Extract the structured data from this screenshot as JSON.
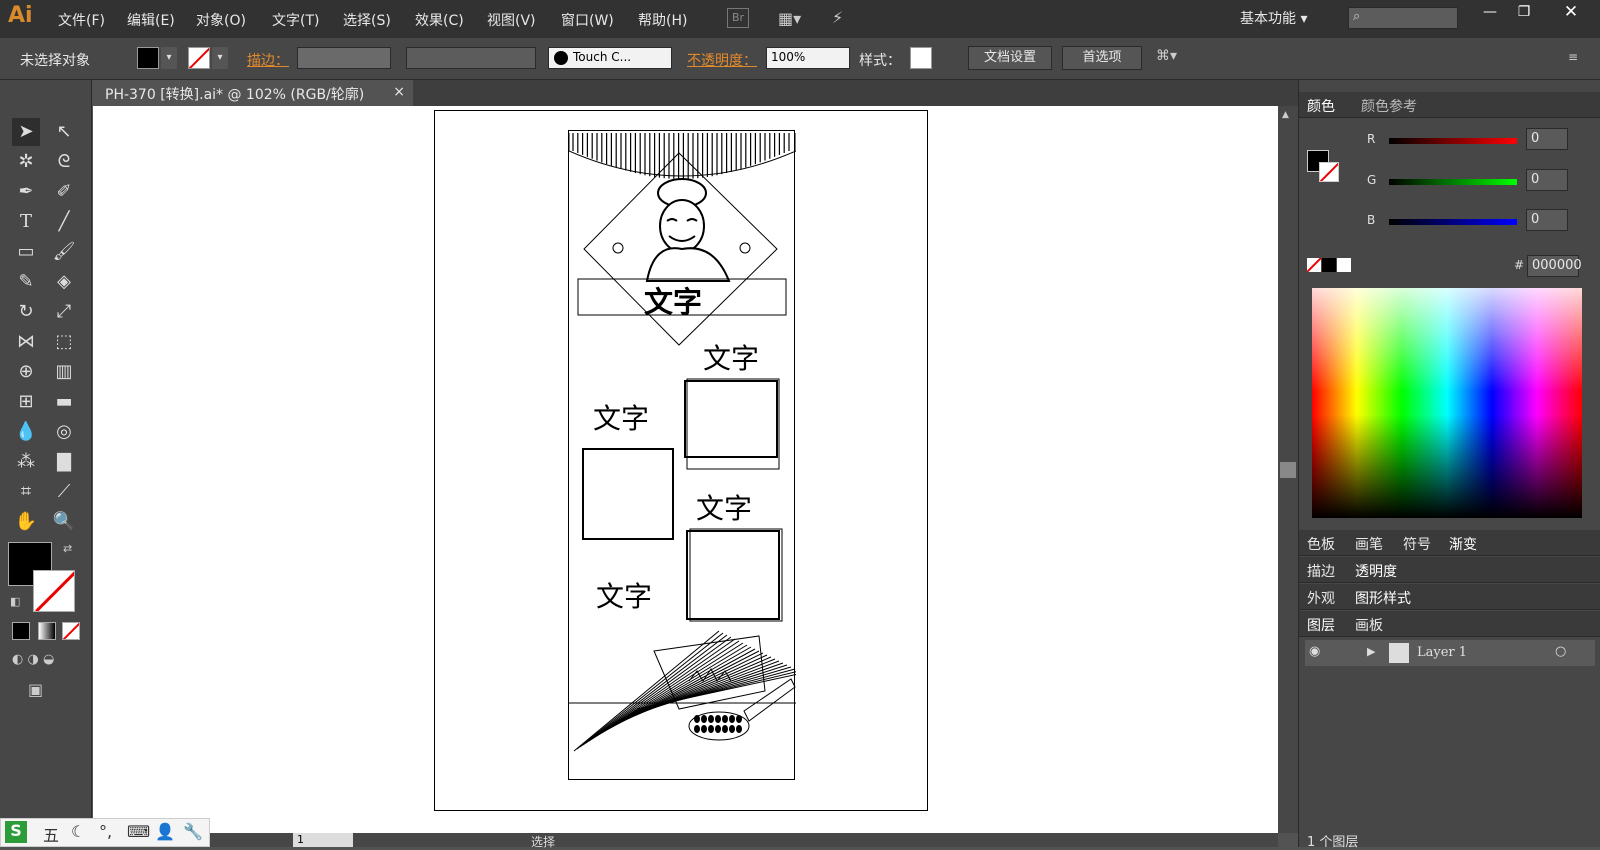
{
  "app": {
    "logo": "Ai",
    "workspace": "基本功能"
  },
  "menu": [
    "文件(F)",
    "编辑(E)",
    "对象(O)",
    "文字(T)",
    "选择(S)",
    "效果(C)",
    "视图(V)",
    "窗口(W)",
    "帮助(H)"
  ],
  "bridge_label": "Br",
  "control": {
    "selection_status": "未选择对象",
    "stroke_label": "描边：",
    "brush_value": "Touch C...",
    "opacity_label": "不透明度：",
    "opacity_value": "100%",
    "style_label": "样式：",
    "doc_setup": "文档设置",
    "preferences": "首选项"
  },
  "document": {
    "tab_title": "PH-370 [转换].ai* @ 102% (RGB/轮廓)",
    "close": "×"
  },
  "artwork": {
    "label_banner": "文字",
    "label_1": "文字",
    "label_2": "文字",
    "label_3": "文字",
    "label_4": "文字"
  },
  "color_panel": {
    "tabs": [
      "颜色",
      "颜色参考"
    ],
    "r_label": "R",
    "g_label": "G",
    "b_label": "B",
    "r_value": "0",
    "g_value": "0",
    "b_value": "0",
    "hash_label": "#",
    "hex_value": "000000"
  },
  "panel_groups": {
    "group1": [
      "色板",
      "画笔",
      "符号",
      "渐变"
    ],
    "group2": [
      "描边",
      "透明度"
    ],
    "group3": [
      "外观",
      "图形样式"
    ],
    "group4": [
      "图层",
      "画板"
    ]
  },
  "layers": {
    "layer_name": "Layer 1",
    "count": "1 个图层"
  },
  "status": {
    "page": "1",
    "mode": "选择"
  },
  "ime": {
    "label": "五"
  },
  "colors": {
    "accent": "#d98a2b",
    "panel": "#474747",
    "canvas": "#ffffff",
    "dark": "#323232"
  }
}
